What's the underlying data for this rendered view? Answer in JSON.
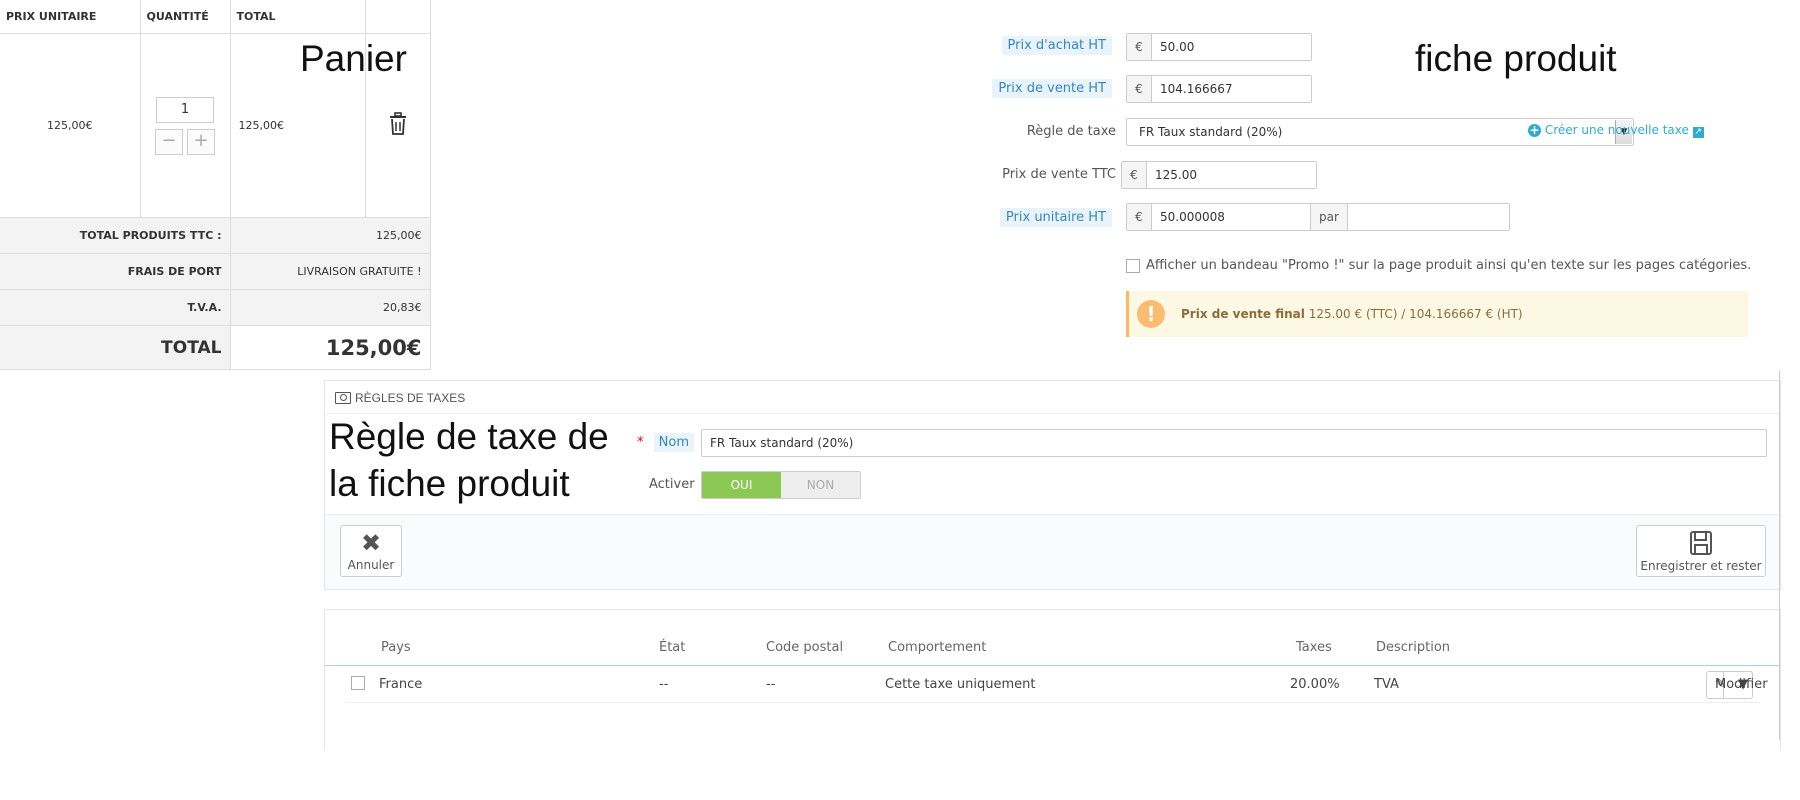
{
  "cart": {
    "headers": [
      "PRIX UNITAIRE",
      "QUANTITÉ",
      "TOTAL"
    ],
    "item": {
      "unit_price": "125,00€",
      "quantity": "1",
      "total": "125,00€"
    },
    "qty_minus": "−",
    "qty_plus": "+",
    "summary": [
      {
        "label": "TOTAL PRODUITS TTC :",
        "value": "125,00€"
      },
      {
        "label": "FRAIS DE PORT",
        "value": "LIVRAISON GRATUITE !"
      },
      {
        "label": "T.V.A.",
        "value": "20,83€"
      }
    ],
    "grand_total": {
      "label": "TOTAL",
      "value": "125,00€"
    }
  },
  "annotations": {
    "panier": "Panier",
    "fiche_produit": "fiche produit",
    "regle_line1": "Règle de taxe de",
    "regle_line2": "la fiche produit"
  },
  "product": {
    "purchase_price": {
      "label": "Prix d'achat HT",
      "currency": "€",
      "value": "50.00"
    },
    "sale_price_ht": {
      "label": "Prix de vente HT",
      "currency": "€",
      "value": "104.166667"
    },
    "tax_rule": {
      "label": "Règle de taxe",
      "value": "FR Taux standard (20%)",
      "create_link": "Créer une nouvelle taxe"
    },
    "sale_price_ttc": {
      "label": "Prix de vente TTC",
      "currency": "€",
      "value": "125.00"
    },
    "unit_price_ht": {
      "label": "Prix unitaire HT",
      "currency": "€",
      "value": "50.000008",
      "per": "par",
      "unit_value": ""
    },
    "promo_checkbox": "Afficher un bandeau \"Promo !\" sur la page produit ainsi qu'en texte sur les pages catégories.",
    "final_price": {
      "label": "Prix de vente final",
      "value": "125.00 € (TTC) / 104.166667 € (HT)"
    }
  },
  "tax_panel": {
    "title": "RÈGLES DE TAXES",
    "name_label": "Nom",
    "name_value": "FR Taux standard (20%)",
    "active_label": "Activer",
    "toggle_on": "OUI",
    "toggle_off": "NON",
    "cancel": "Annuler",
    "save_stay": "Enregistrer et rester"
  },
  "tax_table": {
    "columns": [
      "Pays",
      "État",
      "Code postal",
      "Comportement",
      "Taxes",
      "Description"
    ],
    "rows": [
      {
        "pays": "France",
        "etat": "--",
        "code_postal": "--",
        "comportement": "Cette taxe uniquement",
        "taxes": "20.00%",
        "description": "TVA",
        "action": "Modifier"
      }
    ]
  }
}
